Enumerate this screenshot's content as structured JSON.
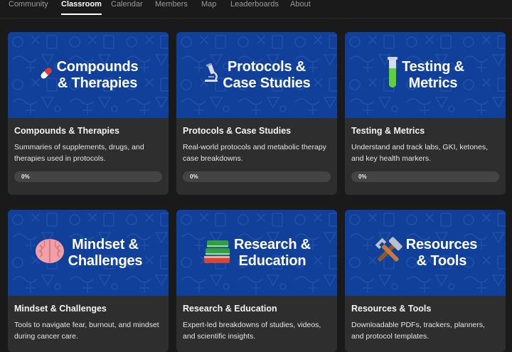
{
  "nav": {
    "tabs": [
      {
        "label": "Community",
        "active": false
      },
      {
        "label": "Classroom",
        "active": true
      },
      {
        "label": "Calendar",
        "active": false
      },
      {
        "label": "Members",
        "active": false
      },
      {
        "label": "Map",
        "active": false
      },
      {
        "label": "Leaderboards",
        "active": false
      },
      {
        "label": "About",
        "active": false
      }
    ]
  },
  "colors": {
    "banner": "#11409a",
    "card": "#2e2e2e",
    "page": "#1a1a1a",
    "progress_track": "#444444"
  },
  "courses": [
    {
      "banner_icon": "pill-icon",
      "banner_line1": "Compounds",
      "banner_line2": "& Therapies",
      "title": "Compounds & Therapies",
      "description": "Summaries of supplements, drugs, and therapies used in protocols.",
      "progress": 0,
      "progress_label": "0%"
    },
    {
      "banner_icon": "microscope-icon",
      "banner_line1": "Protocols &",
      "banner_line2": "Case Studies",
      "title": "Protocols & Case Studies",
      "description": "Real-world protocols and metabolic therapy case breakdowns.",
      "progress": 0,
      "progress_label": "0%"
    },
    {
      "banner_icon": "test-tube-icon",
      "banner_line1": "Testing &",
      "banner_line2": "Metrics",
      "title": "Testing & Metrics",
      "description": "Understand and track labs, GKI, ketones, and key health markers.",
      "progress": 0,
      "progress_label": "0%"
    },
    {
      "banner_icon": "brain-icon",
      "banner_line1": "Mindset &",
      "banner_line2": "Challenges",
      "title": "Mindset & Challenges",
      "description": "Tools to navigate fear, burnout, and mindset during cancer care."
    },
    {
      "banner_icon": "books-icon",
      "banner_line1": "Research &",
      "banner_line2": "Education",
      "title": "Research & Education",
      "description": "Expert-led breakdowns of studies, videos, and scientific insights."
    },
    {
      "banner_icon": "tools-icon",
      "banner_line1": "Resources",
      "banner_line2": "& Tools",
      "title": "Resources & Tools",
      "description": "Downloadable PDFs, trackers, planners, and protocol templates."
    }
  ]
}
